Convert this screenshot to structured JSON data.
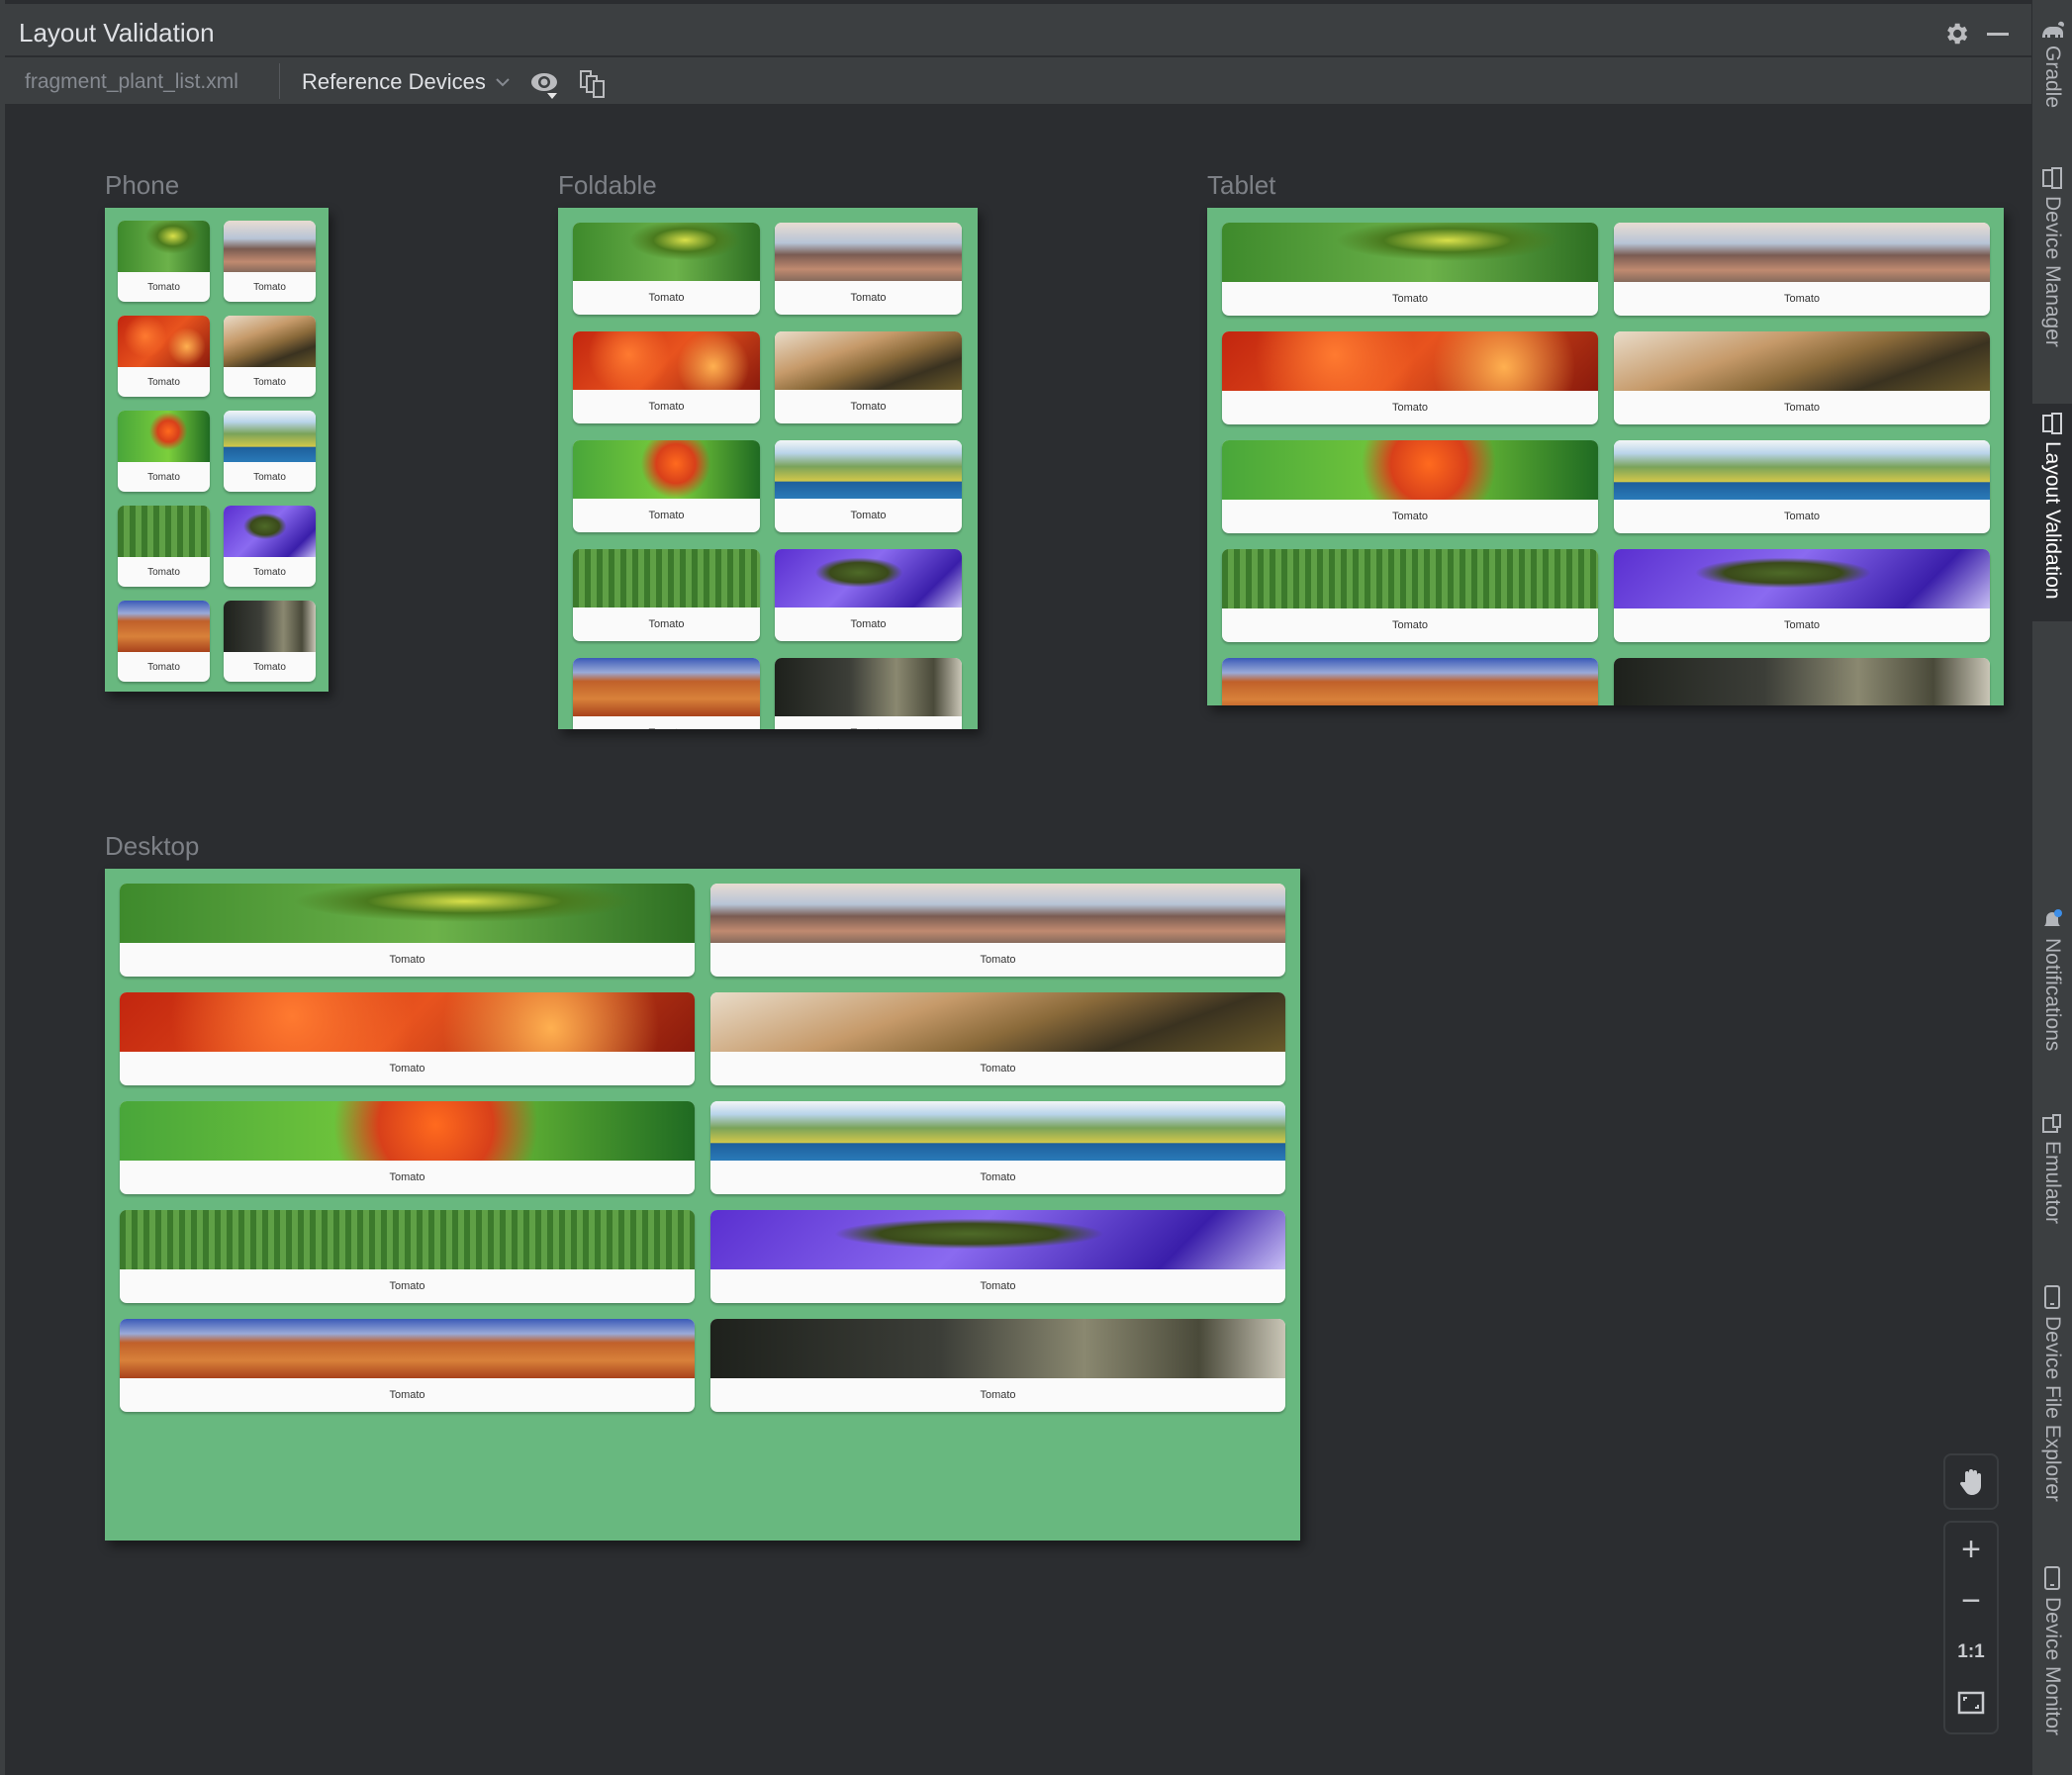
{
  "window": {
    "title": "Layout Validation",
    "settings_icon": "gear-icon",
    "minimize_icon": "minimize-icon"
  },
  "toolbar": {
    "file_name": "fragment_plant_list.xml",
    "device_set": "Reference Devices",
    "visibility_icon": "eye-icon",
    "multi_device_icon": "multi-device-icon"
  },
  "right_sidebar": {
    "tabs": [
      {
        "label": "Gradle",
        "icon": "gradle-elephant-icon",
        "active": false
      },
      {
        "label": "Device Manager",
        "icon": "device-manager-icon",
        "active": false
      },
      {
        "label": "Layout Validation",
        "icon": "layout-validation-icon",
        "active": true
      },
      {
        "label": "Notifications",
        "icon": "bell-icon",
        "active": false
      },
      {
        "label": "Emulator",
        "icon": "emulator-icon",
        "active": false
      },
      {
        "label": "Device File Explorer",
        "icon": "phone-icon",
        "active": false
      },
      {
        "label": "Device Monitor",
        "icon": "phone-icon",
        "active": false
      }
    ]
  },
  "devices": [
    {
      "name": "Phone"
    },
    {
      "name": "Foldable"
    },
    {
      "name": "Tablet"
    },
    {
      "name": "Desktop"
    }
  ],
  "plants": [
    {
      "name": "Tomato",
      "image": "caterpillar-on-plant"
    },
    {
      "name": "Tomato",
      "image": "telescope-over-city"
    },
    {
      "name": "Tomato",
      "image": "red-maple-leaves"
    },
    {
      "name": "Tomato",
      "image": "dew-on-wooden-rail"
    },
    {
      "name": "Tomato",
      "image": "orange-leaf-on-green"
    },
    {
      "name": "Tomato",
      "image": "coastal-landscape"
    },
    {
      "name": "Tomato",
      "image": "aerial-farm"
    },
    {
      "name": "Tomato",
      "image": "purple-stream"
    },
    {
      "name": "Tomato",
      "image": "desert-buttes"
    },
    {
      "name": "Tomato",
      "image": "sepia-forest-tree"
    }
  ],
  "zoom_controls": {
    "pan_icon": "hand-icon",
    "zoom_in": "+",
    "zoom_out": "−",
    "actual_size": "1:1",
    "fit_icon": "fit-screen-icon"
  },
  "colors": {
    "frame_background": "#68b87f",
    "card_background": "#fafafa",
    "panel_background": "#2b2d30"
  }
}
